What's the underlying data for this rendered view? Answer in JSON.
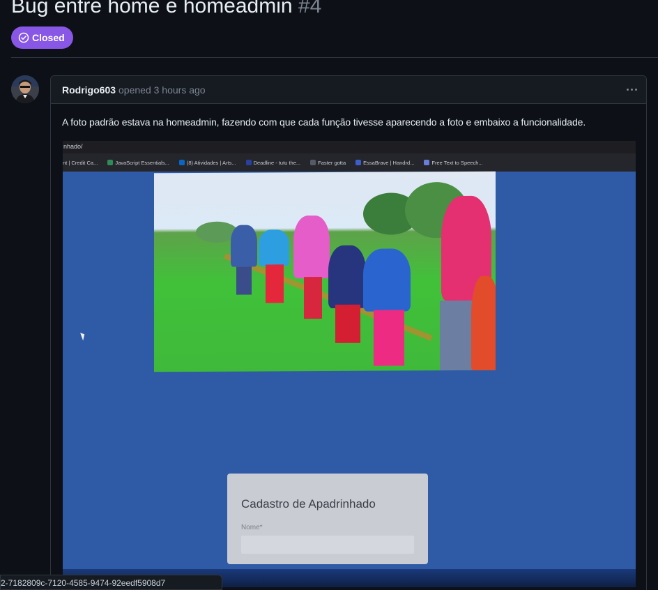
{
  "issue": {
    "title": "Bug entre home e homeadmin",
    "number": "#4",
    "state_label": "Closed",
    "state_color": "#8957e5"
  },
  "comment": {
    "author": "Rodrigo603",
    "meta": "opened 3 hours ago",
    "body": "A foto padrão estava na homeadmin, fazendo com que cada função tivesse aparecendo a foto e embaixo a funcionalidade."
  },
  "attachment": {
    "url_fragment": "nhado/",
    "bookmarks": [
      "nt | Credit Ca...",
      "JavaScript Essentials...",
      "(8) Atividades | Arts...",
      "Deadline - tutu the...",
      "Faster gotta",
      "EssaBrave | Handrd...",
      "Free Text to Speech..."
    ],
    "form_title": "Cadastro de Apadrinhado",
    "form_label": "Nome*"
  },
  "status_bar": {
    "text": "2-7182809c-7120-4585-9474-92eedf5908d7"
  },
  "colors": {
    "background": "#0d1117",
    "border": "#30363d",
    "header_bg": "#161b22",
    "muted": "#7d8590"
  }
}
